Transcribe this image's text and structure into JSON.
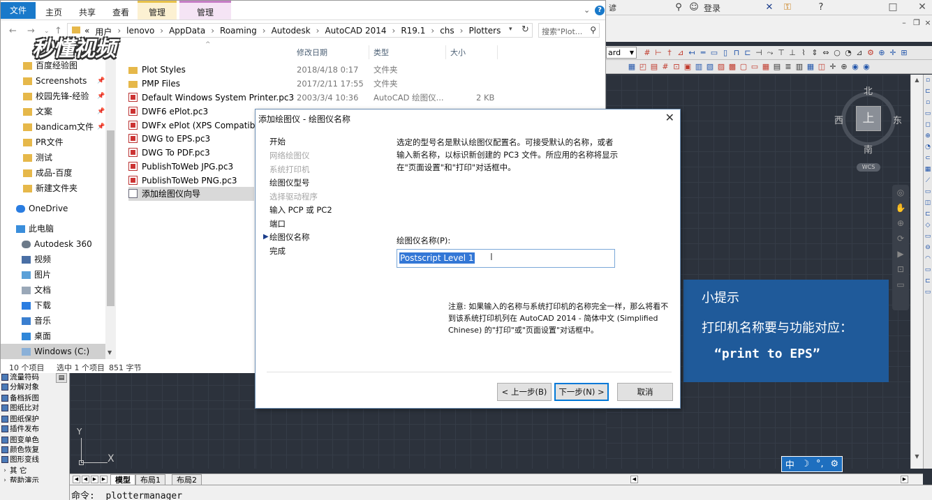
{
  "explorer": {
    "ribbon_tabs": [
      "文件",
      "主页",
      "共享",
      "查看"
    ],
    "context_tabs": [
      "管理",
      "管理"
    ],
    "breadcrumbs": [
      "«",
      "用户",
      "lenovo",
      "AppData",
      "Roaming",
      "Autodesk",
      "AutoCAD 2014",
      "R19.1",
      "chs",
      "Plotters"
    ],
    "search_placeholder": "搜索\"Plot...",
    "columns": {
      "date": "修改日期",
      "type": "类型",
      "size": "大小"
    },
    "nav_items": [
      {
        "label": "百度经验图",
        "icon": "folder-icon"
      },
      {
        "label": "Screenshots",
        "icon": "folder-icon"
      },
      {
        "label": "校园先锋-经验",
        "icon": "folder-icon"
      },
      {
        "label": "文案",
        "icon": "folder-icon"
      },
      {
        "label": "bandicam文件",
        "icon": "folder-icon"
      },
      {
        "label": "PR文件",
        "icon": "folder-icon"
      },
      {
        "label": "测试",
        "icon": "folder-icon"
      },
      {
        "label": "成品-百度",
        "icon": "folder-icon"
      },
      {
        "label": "新建文件夹",
        "icon": "folder-icon"
      },
      {
        "label": "OneDrive",
        "icon": "cloud-icon"
      },
      {
        "label": "此电脑",
        "icon": "computer-icon"
      },
      {
        "label": "Autodesk 360",
        "icon": "cloud-icon"
      },
      {
        "label": "视频",
        "icon": "video-icon"
      },
      {
        "label": "图片",
        "icon": "picture-icon"
      },
      {
        "label": "文档",
        "icon": "document-icon"
      },
      {
        "label": "下载",
        "icon": "download-icon"
      },
      {
        "label": "音乐",
        "icon": "music-icon"
      },
      {
        "label": "桌面",
        "icon": "desktop-icon"
      },
      {
        "label": "Windows (C:)",
        "icon": "drive-icon"
      }
    ],
    "files": [
      {
        "name": "Plot Styles",
        "date": "2018/4/18 0:17",
        "type": "文件夹",
        "size": "",
        "icon": "folder-icon"
      },
      {
        "name": "PMP Files",
        "date": "2017/2/11 17:55",
        "type": "文件夹",
        "size": "",
        "icon": "folder-icon"
      },
      {
        "name": "Default Windows System Printer.pc3",
        "date": "2003/3/4 10:36",
        "type": "AutoCAD 绘图仪...",
        "size": "2 KB",
        "icon": "pc3-icon"
      },
      {
        "name": "DWF6 ePlot.pc3",
        "date": "",
        "type": "",
        "size": "",
        "icon": "pc3-icon"
      },
      {
        "name": "DWFx ePlot (XPS Compatible)...",
        "date": "",
        "type": "",
        "size": "",
        "icon": "pc3-icon"
      },
      {
        "name": "DWG to EPS.pc3",
        "date": "",
        "type": "",
        "size": "",
        "icon": "pc3-icon"
      },
      {
        "name": "DWG To PDF.pc3",
        "date": "",
        "type": "",
        "size": "",
        "icon": "pc3-icon"
      },
      {
        "name": "PublishToWeb JPG.pc3",
        "date": "",
        "type": "",
        "size": "",
        "icon": "pc3-icon"
      },
      {
        "name": "PublishToWeb PNG.pc3",
        "date": "",
        "type": "",
        "size": "",
        "icon": "pc3-icon"
      },
      {
        "name": "添加绘图仪向导",
        "date": "",
        "type": "",
        "size": "",
        "icon": "wizard-icon"
      }
    ],
    "status": {
      "count": "10 个项目",
      "selected": "选中 1 个项目",
      "size": "851 字节"
    },
    "watermark": "秒懂视频"
  },
  "dialog": {
    "title": "添加绘图仪 - 绘图仪名称",
    "steps": [
      {
        "label": "开始",
        "enabled": true
      },
      {
        "label": "网络绘图仪",
        "enabled": false
      },
      {
        "label": "系统打印机",
        "enabled": false
      },
      {
        "label": "绘图仪型号",
        "enabled": true
      },
      {
        "label": "选择驱动程序",
        "enabled": false
      },
      {
        "label": "输入 PCP 或 PC2",
        "enabled": true
      },
      {
        "label": "端口",
        "enabled": true
      },
      {
        "label": "绘图仪名称",
        "enabled": true
      },
      {
        "label": "完成",
        "enabled": true
      }
    ],
    "description": "选定的型号名是默认绘图仪配置名。可接受默认的名称，或者输入新名称，以标识新创建的 PC3 文件。所应用的名称将显示在\"页面设置\"和\"打印\"对话框中。",
    "field_label": "绘图仪名称(P):",
    "field_value": "Postscript Level 1",
    "note": "注意: 如果输入的名称与系统打印机的名称完全一样，那么将看不到该系统打印机列在 AutoCAD 2014 - 简体中文 (Simplified Chinese) 的\"打印\"或\"页面设置\"对话框中。",
    "buttons": {
      "back": "< 上一步(B)",
      "next": "下一步(N) >",
      "cancel": "取消"
    }
  },
  "autocad": {
    "search_fragment": "谚",
    "login": "登录",
    "combo": "ard",
    "viewcube": {
      "top": "上",
      "north": "北",
      "south": "南",
      "east": "东",
      "west": "西",
      "wcs": "WCS"
    },
    "tabs": [
      "模型",
      "布局1",
      "布局2"
    ],
    "command": "命令: _plottermanager",
    "left_panel": [
      "流量符码",
      "分解对象",
      "备档拆图",
      "图纸比对",
      "图纸保护",
      "插件发布",
      "图变单色",
      "颜色恢复",
      "图形变线",
      "其    它",
      "帮助演示"
    ],
    "ucs": {
      "x": "X",
      "y": "Y"
    }
  },
  "tip": {
    "title": "小提示",
    "line": "打印机名称要与功能对应：",
    "code": "“print to EPS”"
  },
  "ime": {
    "label": "中"
  }
}
